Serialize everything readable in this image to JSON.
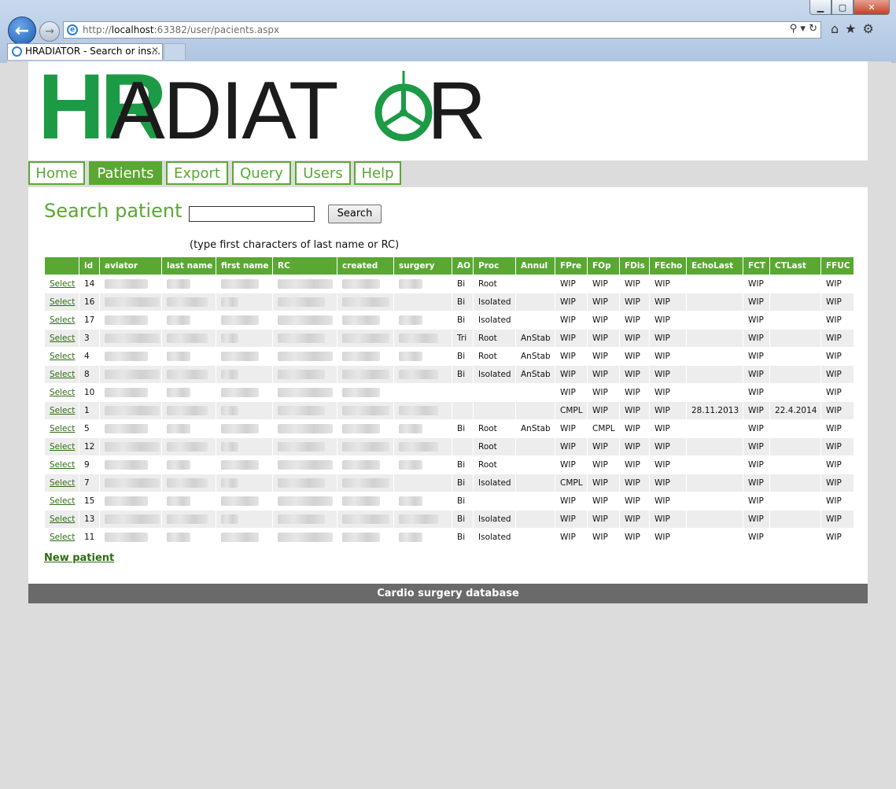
{
  "browser": {
    "url_prefix": "http://",
    "url_host": "localhost",
    "url_rest": ":63382/user/pacients.aspx",
    "tab_title": "HRADIATOR - Search or ins...",
    "tab_close": "✕"
  },
  "logo": {
    "hr": "HR",
    "radiat": "ADIAT",
    "end": "R"
  },
  "nav": [
    {
      "label": "Home",
      "active": false
    },
    {
      "label": "Patients",
      "active": true
    },
    {
      "label": "Export",
      "active": false
    },
    {
      "label": "Query",
      "active": false
    },
    {
      "label": "Users",
      "active": false
    },
    {
      "label": "Help",
      "active": false
    }
  ],
  "search": {
    "title": "Search patient",
    "input_value": "",
    "button_label": "Search",
    "hint": "(type first characters of last name or RC)"
  },
  "table": {
    "columns": [
      "",
      "id",
      "aviator",
      "last name",
      "first name",
      "RC",
      "created",
      "surgery",
      "AO",
      "Proc",
      "Annul",
      "FPre",
      "FOp",
      "FDis",
      "FEcho",
      "EchoLast",
      "FCT",
      "CTLast",
      "FFUC"
    ],
    "rows": [
      {
        "select": "Select",
        "id": "14",
        "ao": "Bi",
        "proc": "Root",
        "annul": "",
        "fpre": "WIP",
        "fop": "WIP",
        "fdis": "WIP",
        "fecho": "WIP",
        "echolast": "",
        "fct": "WIP",
        "ctlast": "",
        "ffuc": "WIP"
      },
      {
        "select": "Select",
        "id": "16",
        "ao": "Bi",
        "proc": "Isolated",
        "annul": "",
        "fpre": "WIP",
        "fop": "WIP",
        "fdis": "WIP",
        "fecho": "WIP",
        "echolast": "",
        "fct": "WIP",
        "ctlast": "",
        "ffuc": "WIP"
      },
      {
        "select": "Select",
        "id": "17",
        "ao": "Bi",
        "proc": "Isolated",
        "annul": "",
        "fpre": "WIP",
        "fop": "WIP",
        "fdis": "WIP",
        "fecho": "WIP",
        "echolast": "",
        "fct": "WIP",
        "ctlast": "",
        "ffuc": "WIP"
      },
      {
        "select": "Select",
        "id": "3",
        "ao": "Tri",
        "proc": "Root",
        "annul": "AnStab",
        "fpre": "WIP",
        "fop": "WIP",
        "fdis": "WIP",
        "fecho": "WIP",
        "echolast": "",
        "fct": "WIP",
        "ctlast": "",
        "ffuc": "WIP"
      },
      {
        "select": "Select",
        "id": "4",
        "ao": "Bi",
        "proc": "Root",
        "annul": "AnStab",
        "fpre": "WIP",
        "fop": "WIP",
        "fdis": "WIP",
        "fecho": "WIP",
        "echolast": "",
        "fct": "WIP",
        "ctlast": "",
        "ffuc": "WIP"
      },
      {
        "select": "Select",
        "id": "8",
        "ao": "Bi",
        "proc": "Isolated",
        "annul": "AnStab",
        "fpre": "WIP",
        "fop": "WIP",
        "fdis": "WIP",
        "fecho": "WIP",
        "echolast": "",
        "fct": "WIP",
        "ctlast": "",
        "ffuc": "WIP"
      },
      {
        "select": "Select",
        "id": "10",
        "ao": "",
        "proc": "",
        "annul": "",
        "fpre": "WIP",
        "fop": "WIP",
        "fdis": "WIP",
        "fecho": "WIP",
        "echolast": "",
        "fct": "WIP",
        "ctlast": "",
        "ffuc": "WIP"
      },
      {
        "select": "Select",
        "id": "1",
        "ao": "",
        "proc": "",
        "annul": "",
        "fpre": "CMPL",
        "fop": "WIP",
        "fdis": "WIP",
        "fecho": "WIP",
        "echolast": "28.11.2013",
        "fct": "WIP",
        "ctlast": "22.4.2014",
        "ffuc": "WIP"
      },
      {
        "select": "Select",
        "id": "5",
        "ao": "Bi",
        "proc": "Root",
        "annul": "AnStab",
        "fpre": "WIP",
        "fop": "CMPL",
        "fdis": "WIP",
        "fecho": "WIP",
        "echolast": "",
        "fct": "WIP",
        "ctlast": "",
        "ffuc": "WIP"
      },
      {
        "select": "Select",
        "id": "12",
        "ao": "",
        "proc": "Root",
        "annul": "",
        "fpre": "WIP",
        "fop": "WIP",
        "fdis": "WIP",
        "fecho": "WIP",
        "echolast": "",
        "fct": "WIP",
        "ctlast": "",
        "ffuc": "WIP"
      },
      {
        "select": "Select",
        "id": "9",
        "ao": "Bi",
        "proc": "Root",
        "annul": "",
        "fpre": "WIP",
        "fop": "WIP",
        "fdis": "WIP",
        "fecho": "WIP",
        "echolast": "",
        "fct": "WIP",
        "ctlast": "",
        "ffuc": "WIP"
      },
      {
        "select": "Select",
        "id": "7",
        "ao": "Bi",
        "proc": "Isolated",
        "annul": "",
        "fpre": "CMPL",
        "fop": "WIP",
        "fdis": "WIP",
        "fecho": "WIP",
        "echolast": "",
        "fct": "WIP",
        "ctlast": "",
        "ffuc": "WIP"
      },
      {
        "select": "Select",
        "id": "15",
        "ao": "Bi",
        "proc": "",
        "annul": "",
        "fpre": "WIP",
        "fop": "WIP",
        "fdis": "WIP",
        "fecho": "WIP",
        "echolast": "",
        "fct": "WIP",
        "ctlast": "",
        "ffuc": "WIP"
      },
      {
        "select": "Select",
        "id": "13",
        "ao": "Bi",
        "proc": "Isolated",
        "annul": "",
        "fpre": "WIP",
        "fop": "WIP",
        "fdis": "WIP",
        "fecho": "WIP",
        "echolast": "",
        "fct": "WIP",
        "ctlast": "",
        "ffuc": "WIP"
      },
      {
        "select": "Select",
        "id": "11",
        "ao": "Bi",
        "proc": "Isolated",
        "annul": "",
        "fpre": "WIP",
        "fop": "WIP",
        "fdis": "WIP",
        "fecho": "WIP",
        "echolast": "",
        "fct": "WIP",
        "ctlast": "",
        "ffuc": "WIP"
      }
    ]
  },
  "new_patient_label": "New patient",
  "footer_text": "Cardio surgery database",
  "colors": {
    "accent_green": "#5aa832",
    "logo_green": "#1d9a46",
    "footer_gray": "#6a6a6a"
  }
}
